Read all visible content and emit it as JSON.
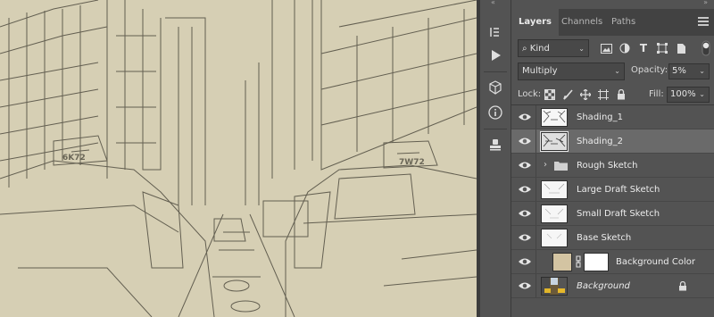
{
  "panel": {
    "tabs": [
      {
        "label": "Layers"
      },
      {
        "label": "Channels"
      },
      {
        "label": "Paths"
      }
    ],
    "filter": {
      "kind_label": "Kind"
    },
    "blend_mode": "Multiply",
    "opacity": {
      "label": "Opacity:",
      "value": "5%"
    },
    "lock": {
      "label": "Lock:"
    },
    "fill": {
      "label": "Fill:",
      "value": "100%"
    }
  },
  "layers": [
    {
      "name": "Shading_1"
    },
    {
      "name": "Shading_2"
    },
    {
      "name": "Rough Sketch"
    },
    {
      "name": "Large Draft Sketch"
    },
    {
      "name": "Small Draft Sketch"
    },
    {
      "name": "Base Sketch"
    },
    {
      "name": "Background Color"
    },
    {
      "name": "Background"
    }
  ],
  "colors": {
    "panel_bg": "#535353",
    "tab_bar": "#424242",
    "selected_layer": "#6a6a6a",
    "canvas_paper": "#d6cfb4",
    "background_color_swatch": "#d3c4a2"
  },
  "icons": {
    "toolstrip": [
      "history-icon",
      "play-icon",
      "3d-cube-icon",
      "info-icon",
      "stamp-icon"
    ],
    "filters": [
      "image-filter-icon",
      "adjustment-filter-icon",
      "type-filter-icon",
      "shape-filter-icon",
      "smart-object-filter-icon"
    ],
    "locks": [
      "lock-pixels-icon",
      "lock-paint-icon",
      "lock-position-icon",
      "lock-artboard-icon",
      "lock-all-icon"
    ]
  }
}
